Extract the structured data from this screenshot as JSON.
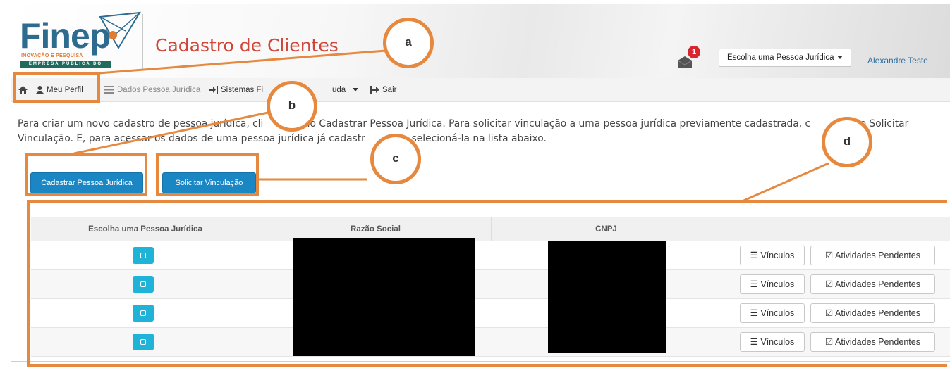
{
  "header": {
    "logo_word": "Finep",
    "logo_tagline": "INOVAÇÃO E PESQUISA",
    "logo_band": "EMPRESA PÚBLICA DO MCTI",
    "app_title": "Cadastro de Clientes",
    "notification_count": "1",
    "pj_select_label": "Escolha uma Pessoa Jurídica",
    "user_name": "Alexandre Teste"
  },
  "navbar": {
    "home_icon": "home-icon",
    "profile": "Meu Perfil",
    "pj_data": "Dados Pessoa Jurídica",
    "systems": "Sistemas Fi",
    "help": "uda",
    "logout": "Sair"
  },
  "intro": {
    "line1": "Para criar um novo cadastro de pessoa jurídica, cli          otão Cadastrar Pessoa Jurídica. Para solicitar vinculação a uma pessoa jurídica previamente cadastrada, c         botão Solicitar",
    "line2": "Vinculação. E, para acessar os dados de uma pessoa jurídica já cadastr               selecioná-la na lista abaixo."
  },
  "actions": {
    "register": "Cadastrar Pessoa Jurídica",
    "request_link": "Solicitar Vinculação"
  },
  "table": {
    "headers": [
      "Escolha uma Pessoa Jurídica",
      "Razão Social",
      "CNPJ",
      ""
    ],
    "rows": [
      {
        "vinculos": "Vínculos",
        "pendentes": "Atividades Pendentes"
      },
      {
        "vinculos": "Vínculos",
        "pendentes": "Atividades Pendentes"
      },
      {
        "vinculos": "Vínculos",
        "pendentes": "Atividades Pendentes"
      },
      {
        "vinculos": "Vínculos",
        "pendentes": "Atividades Pendentes"
      }
    ]
  },
  "annotations": {
    "a": "a",
    "b": "b",
    "c": "c",
    "d": "d"
  },
  "colors": {
    "accent": "#1b86c4",
    "annotation": "#e6893e",
    "title": "#d0473a"
  }
}
